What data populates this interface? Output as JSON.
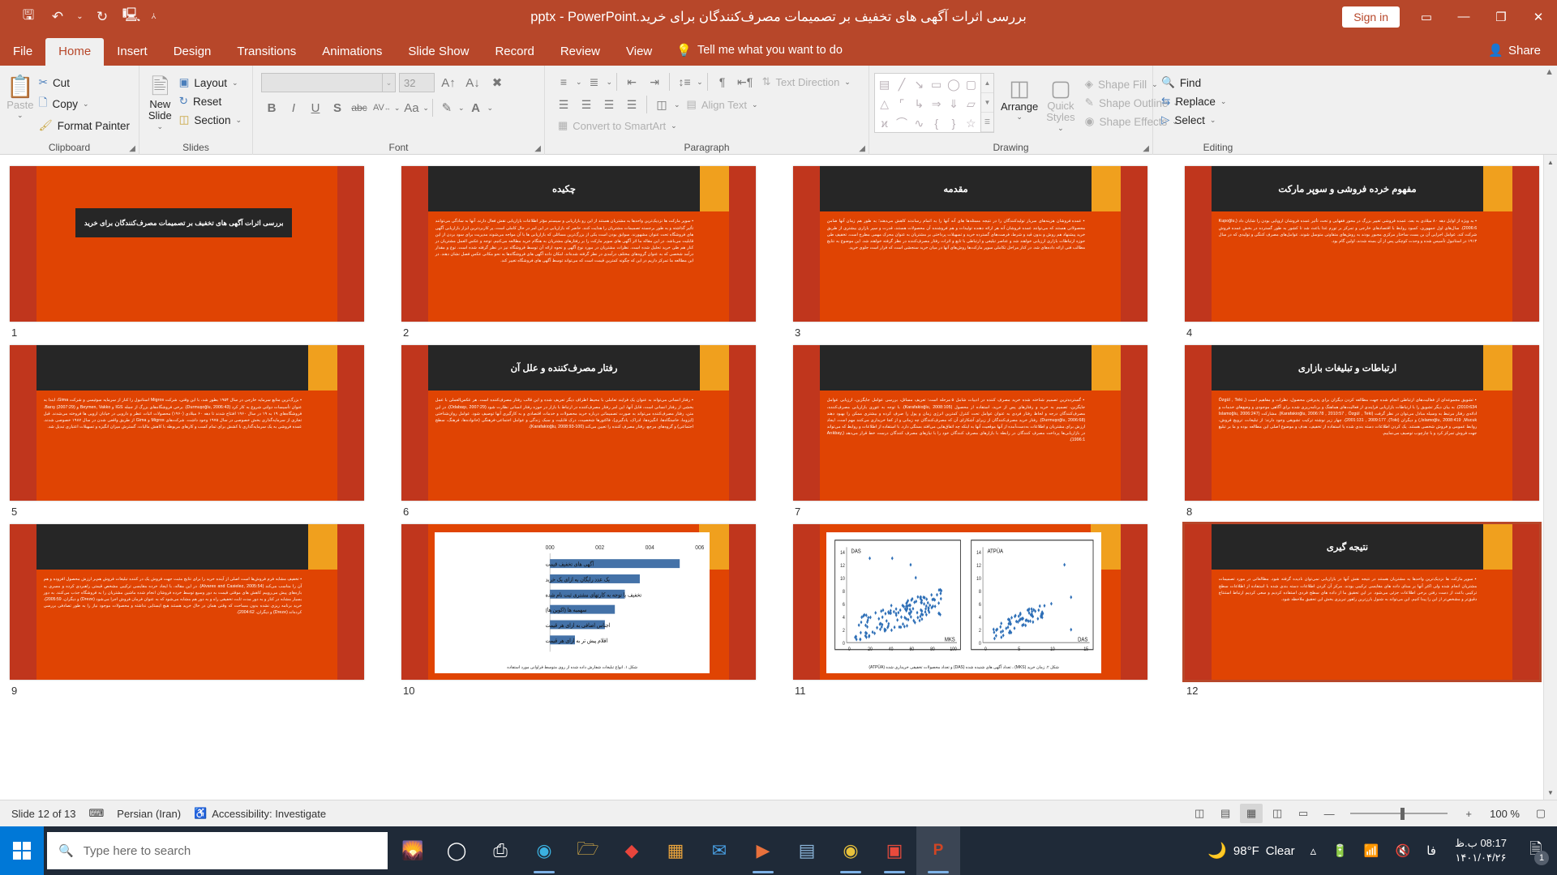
{
  "titlebar": {
    "document_title": "بررسی اثرات آگهی های تخفیف بر تصمیمات مصرف‌کنندگان برای خرید.pptx  -  PowerPoint",
    "signin_label": "Sign in",
    "qat": [
      {
        "name": "save-icon",
        "glyph": "🖫"
      },
      {
        "name": "undo-icon",
        "glyph": "↶"
      },
      {
        "name": "undo-dropdown-icon",
        "glyph": "⌄"
      },
      {
        "name": "redo-icon",
        "glyph": "↻"
      },
      {
        "name": "start-from-beginning-icon",
        "glyph": "🖳"
      },
      {
        "name": "customize-qat-icon",
        "glyph": "⩑"
      }
    ],
    "window_controls": [
      {
        "name": "ribbon-display-options-icon",
        "glyph": "▭"
      },
      {
        "name": "minimize-icon",
        "glyph": "—"
      },
      {
        "name": "restore-icon",
        "glyph": "❐"
      },
      {
        "name": "close-icon",
        "glyph": "✕"
      }
    ]
  },
  "tabs": [
    {
      "label": "File",
      "active": false
    },
    {
      "label": "Home",
      "active": true
    },
    {
      "label": "Insert",
      "active": false
    },
    {
      "label": "Design",
      "active": false
    },
    {
      "label": "Transitions",
      "active": false
    },
    {
      "label": "Animations",
      "active": false
    },
    {
      "label": "Slide Show",
      "active": false
    },
    {
      "label": "Record",
      "active": false
    },
    {
      "label": "Review",
      "active": false
    },
    {
      "label": "View",
      "active": false
    }
  ],
  "tellme": {
    "label": "Tell me what you want to do",
    "icon": "lightbulb-icon"
  },
  "share": {
    "label": "Share",
    "icon": "share-person-icon"
  },
  "ribbon": {
    "clipboard": {
      "group_label": "Clipboard",
      "paste_label": "Paste",
      "items": [
        {
          "label": "Cut",
          "icon": "scissors-icon"
        },
        {
          "label": "Copy",
          "icon": "copy-icon"
        },
        {
          "label": "Format Painter",
          "icon": "paintbrush-icon"
        }
      ]
    },
    "slides": {
      "group_label": "Slides",
      "new_slide_label": "New Slide",
      "items": [
        {
          "label": "Layout",
          "icon": "layout-icon"
        },
        {
          "label": "Reset",
          "icon": "reset-icon"
        },
        {
          "label": "Section",
          "icon": "section-icon"
        }
      ]
    },
    "font": {
      "group_label": "Font",
      "font_name_value": "",
      "font_name_placeholder": "",
      "font_size_value": "32",
      "buttons": [
        {
          "name": "bold-button",
          "glyph": "B"
        },
        {
          "name": "italic-button",
          "glyph": "I"
        },
        {
          "name": "underline-button",
          "glyph": "U"
        },
        {
          "name": "text-shadow-button",
          "glyph": "S"
        },
        {
          "name": "strikethrough-button",
          "glyph": "abc"
        },
        {
          "name": "character-spacing-button",
          "glyph": "AV"
        },
        {
          "name": "change-case-button",
          "glyph": "Aa"
        },
        {
          "name": "text-highlight-button",
          "glyph": "🖉"
        },
        {
          "name": "font-color-button",
          "glyph": "A"
        }
      ],
      "grow_font": "A⌃",
      "shrink_font": "A⌄",
      "clear_formatting": "⌫"
    },
    "paragraph": {
      "group_label": "Paragraph",
      "items": [
        {
          "label": "Text Direction",
          "icon": "text-direction-icon"
        },
        {
          "label": "Align Text",
          "icon": "align-text-icon"
        },
        {
          "label": "Convert to SmartArt",
          "icon": "smartart-icon"
        }
      ],
      "row1": [
        "bullets-icon",
        "numbering-icon",
        "decrease-indent-icon",
        "increase-indent-icon",
        "line-spacing-icon",
        "ltr-icon",
        "rtl-icon"
      ],
      "row2": [
        "align-left-icon",
        "align-center-icon",
        "align-right-icon",
        "justify-icon",
        "columns-icon"
      ]
    },
    "drawing": {
      "group_label": "Drawing",
      "arrange_label": "Arrange",
      "quick_styles_label": "Quick Styles",
      "items": [
        {
          "label": "Shape Fill",
          "icon": "shape-fill-icon"
        },
        {
          "label": "Shape Outline",
          "icon": "shape-outline-icon"
        },
        {
          "label": "Shape Effects",
          "icon": "shape-effects-icon"
        }
      ],
      "shapes": [
        "▤",
        "╲",
        "↘",
        "▭",
        "◯",
        "▢",
        "△",
        "⌐",
        "↳",
        "⇨",
        "⇩",
        "◱",
        "ϟ",
        "⌒",
        "∿",
        "{",
        "}",
        "☆"
      ]
    },
    "editing": {
      "group_label": "Editing",
      "items": [
        {
          "label": "Find",
          "icon": "search-icon"
        },
        {
          "label": "Replace",
          "icon": "replace-icon"
        },
        {
          "label": "Select",
          "icon": "select-icon"
        }
      ]
    }
  },
  "slides": [
    {
      "number": "1",
      "kind": "title",
      "title": "بررسی اثرات آگهی های تخفیف بر تصمیمات مصرف‌کنندگان برای خرید",
      "body": "",
      "selected": false
    },
    {
      "number": "2",
      "kind": "text",
      "title": "چکیده",
      "body": "سوپر مارکت ها نزدیک‌ترین واحدها به مشتریان هستند از این رو بازاریابی و سیستم مؤثر اطلاعات بازاریابی نقش فعال دارند. آنها به سادگی می‌توانند تأثیر گذاشته و به طور برجسته تصمیمات مشتریان را هدایت کنند. حاضر که بازاریابی در این امر در حال کاملی است، پر کاربردترین ابزار بازاریابی آگهی های فروشگاه تحت عنوان مشهورند. سوابق بودن است یکی از بزرگ‌ترین مسائلی که بازاریابی ها با آن مواجه می‌شوند مدیریت برای سود بردن از این قابلیت می‌باشد. در این مقاله ما اثر آگهی های سوپر مارکت را بر رفتارهای مشتریان به هنگام خرید مطالعه می‌کنیم. توجه و عکس العمل مشتریان در کنار هم طی خرید تحلیل شده است. نظرات مشتریان در مورد نوع آگهی و نحوه ارائه آن توسط فروشگاه نیز در نظر گرفته شده است. نوع و مقدار درآمد شخصی که به عنوان گروه‌های مختلف درآمدی در نظر گرفته شده‌اند. امکان داده آگهی های فروشگاه‌ها به نحو مکانی عکس فصل نشان دهند. در این مطالعه ما تمرکز داریم در این که چگونه کمترین قیمت است که می‌تواند توسط آگهی های فروشگاه تغییر کند.",
      "selected": false
    },
    {
      "number": "3",
      "kind": "text",
      "title": "مقدمه",
      "body": "عمده فروشان هزینه‌های سربار تولیدکنندگان را در نتیجه مسئله‌ها های آنه آنها را به اتمام رساندند کاهش می‌دهند؛ به طور هم زمان آنها ضامن محصولاتی هستند که می‌توانند عمده فروشان آنه هر ارائه دهنده تولیدات و هم فروشنده آن محصولات هستند، قدرت و سپر بازاری بیشتری از طریق خرید پیشنهاد هم روش و بدون قید و شرط، فرصت‌های گسترده خرید و تسهیلات پرداختی بر مشتریان به عنوان محرک مهمی مطرح است. تخفیف طی حوزه ارتباطات بازاری ارزیابی خواهند شد و عناصر تبلیغی و ارتباطی با تابع و اثرات رفتار مصرف‌کننده در نظر گرفته خواهند شد. این موضوع به نتایج مطالب فنی ارائه داده‌های شد. در کنار مراحل تکاملی سوپر مارکت‌ها روش‌های آنها در میان خرید سنجشی است که قرار است جلوی خرید.",
      "selected": false
    },
    {
      "number": "4",
      "kind": "text",
      "title": "مفهوم خرده فروشی و سوپر مارکت",
      "body": "به ویژه از اوایل دهه ۸۰ میلادی به بعد، عمده فروشی تغییر بزرگ در محور فقهایی و تحت تأثیر عمده فروشان اروپایی بودن را شایان داد (Kupoğlu, 2006:6). سال‌های اول جمهوری، کمبود روابط با اقتصادهای خارجی و تمرکز بر تورم غذا باعث شد تا کشور به طور گسترده در بخش عمده فروش شرکت کند. عوامل اجرایی آن بن بست ساختار مرکزی مجبور بودند به روش‌های متفاوتی متوسل شوند. عوامل‌های مصرف کننگی و تولیدی که در سال ۱۹۱۳ در استانبول تأسیس شده و وحدت کوچکی پس از آن بسته شدند، اولین گام بود.",
      "selected": false
    },
    {
      "number": "5",
      "kind": "text",
      "title": "",
      "body": "بزرگ‌ترین منابع سرمایه خارجی در سال ۱۹۵۴ بطور شد، با این وقتی، شرکت Migros استانبول را کنار از سرمایه سوئیسی و شرکت Gima، ابتدا به عنوان تأسیسات دولتی شروع به کار کرد (Durmuşoğlu, 2006:43). برخی فروشگاه‌های بزرگ از جمله IGS و Beymen, Vakko و Barış (2007:29). فروشگاه‌های ۱۹ به ۱۹ در سال ۱۹۶۰ افتتاح شدند تا دهه ۶۰ میلادی (۱۹۶۰) محصولات اثبات عطر و دارویی در خیابان اروپی ها فروخته می‌شدند. قبل تجاری از سرمایه‌گذاری بخش خصوصی در سال ۱۹۷۵ وجود داشت. شرکت‌های Migros و Gima از طریق واقعی شدن در سال ۱۹۸۷ خصوصی شدند. عمده فروشی به یک سرمایه‌گذاری با کشش برای تمام کسب و کارهای مربوطه با کاهش مالیات، گسترش میزان انگیزه و تسهیلات اعتباری تبدیل شد.",
      "selected": false
    },
    {
      "number": "6",
      "kind": "text",
      "title": "رفتار مصرف‌کننده و علل آن",
      "body": "رفتار انسانی می‌تواند به عنوان یک فرایند تعاملی با محیط اطراف دیگر تعریف شده و این قالب رفتار مصرف‌کننده است. هر عکس‌العملی با عمل بخشی از رفتار انسانی است، قابل آنها، این امر رفتار مصرف‌کننده در ارتباط با بازار در حوزه رفتار انسانی نظارت شود (Odabaşı, 2007:29). در این متن، رفتار مصرف‌کننده می‌تواند به صورت تصمیماتی درباره خرید محصولات و خدمات اقتصادی و به کارگیری آنها توصیف شود. عوامل روان‌شناختی (ایزوما، خاستگاه‌ها، انگیزه‌ها، ادراک، یادگیری)، فاکتورها شخصیت، درک قابلیت و سبک زندگی و عوامل اجتماعی-فرهنگی (خانواده‌ها، فرهنگ، سطح اجتماعی) و گروه‌های مرجع، رفتار مصرف کننده را تعیین می‌کند (Karafakioğlu, 2008:93-100).",
      "selected": false
    },
    {
      "number": "7",
      "kind": "text",
      "title": "",
      "body": "گسترده‌ترین تصمیم شناخته شده خرید مصرف کننده در ادبیات شامل ۵ مرحله است: تعریف مسائل، بررسی عوامل جایگزین، ارزیابی عوامل جایگزین، تصمیم به خرید و رفتارهای پس از خرید، استفاده از محصول (Karafakioğlu, 2008:105). با توجه به تئوری بازاریابی مصرف‌کننده، مصرف‌کنندگان درجه و لحاظ رفتار فردی به عنوان عوامل تحت کنترل کمترین انرژی زمان و پول را صرف کرده و بیشتری ممکن را بهبود دهند (Durmuşoğlu, 2006:68). رفتار خرید مصرف‌کنندگان از زیرای آشکارای آن که مصرف‌کنندگان چه زمانی و از کجا خریداری می‌کنند مهم است. ایجاد ارزش برای مشتریان و اطلاعات به‌دست‌آمده از آنها موقعیت آنها به اینکه چه اتفاق‌هایی می‌افتد بستگی دارد. با استفاده از اطلاعات و روابط که می‌تواند در بازاریابی‌ها پرداخت مصرف کنندگان در رابطه با بازارهای مصرف کنندگان خود را با نیازهای مصرف کنندگان درست خط قرار می‌دهد (Arıkbay, 1996:1).",
      "selected": false
    },
    {
      "number": "8",
      "kind": "text",
      "title": "ارتباطات و تبلیغات بازاری",
      "body": "تشویق مجموعه‌ای از فعالیت‌های ارتباطی انجام شده جهت مطالعه کردن دیگران برای پذیرفتن محصول، نظرات و مفاهیم است (Özgül , Teki , 2010:634). به بیان دیگر تشویق را با ارتباطات بازاریابی فرایندی از فعالیت‌های هماهنگ و برنامه‌ریزی شده برای آگاهی موجودی و وضع‌های خدمات و ادائه‌ی رفتار مرتبط به وسیله مبادل می‌توان در نظر گرفت (Karafakioğlu, 2006:78 , 2010:57 , Özgül , Teki). مشارکت (Islamoğlu, 2006:247 ,Islamoğlu, 2008:419 ,Mucuk) و دیگران (Toki), 2001:131 , 2009:177). چهار زیر نوشته ترکیب تشویقی وجود دارند: از تبلیغات، ترویج فروش، روابط عمومی و فروش شخصی هستند. یک کردن اطلاعات دسته بندی شده با استفاده از تخفیف، هدف و موضوع اصلی این مطالعه بوده و ما بر تبلیغ جهت فروش تمرکز کرد و با چارچوب توصیف می‌نماییم.",
      "selected": false
    },
    {
      "number": "9",
      "kind": "text",
      "title": "",
      "body": "تخفیف مشابه فرم فروش‌ها است اصلی از آینده خرید را برای نتایج مثبت جهت فروش یک در کننده تبلیغات فروش هم‌بر ارزش محصول افزوده و هم آن را مناسب می‌کند (Alvares and Casielez, 2005:54). در این مقاله، با ایجاد خرده مقایسی ترکیبی مشخص قیمتی راهبردی کرده و مسری به بازه‌های پیش می‌روییم کاهش های موقتی قیمت به دور وسیع توسط خرده فروشان انجام شده ماشین مشتریان را به فروشگاه جذب می‌کنند. به دور بسیار مشابه در کنار و به دور مدت ثابت تخفیقی راه و به دور هم مشابه می‌شود که به عنوان فرمان فروش اجرا می‌شود (Dreze) و دیگران، 2005:59). خرید برنامه ریزی نشده بدون مساحت که وقتی همان در حال خرید هستند هیچ ایستایی نداشته و محصولات موجود نیاز را به طور تصادفی بررسی کرده‌اند (Dreze) و دیگران، 2004:62).",
      "selected": false
    },
    {
      "number": "10",
      "kind": "chart-bar",
      "title": "",
      "body": "",
      "figure_caption": "شکل ۱. انواع تبلیغات شفارش داده شده از روی متوسط فراوانی مورد استفاده",
      "selected": false
    },
    {
      "number": "11",
      "kind": "chart-scatter",
      "title": "",
      "body": "",
      "figure_caption": "شکل ۲. زمان خرید (MKS) ، تعداد آگهی های شنیده شده (DAS) و تعداد محصولات تخفیفی خریداری شده (ATPÜA)",
      "selected": false
    },
    {
      "number": "12",
      "kind": "text",
      "title": "نتیجه گیری",
      "body": "سوپر مارکت ها نزدیک‌ترین واحدها به مشتریان هستند در نتیجه نقش آنها در بازاریابی نمی‌توان نادیده گرفته شود. مطالعاتی در مورد تصمیمات مشتریان انجام شده ولی اکثر آنها بر مبنای داده های مقایسی ترکیبی بودند. مرکز آن کردن اطلاعات دسته بندی شده با استفاده از اطلاعات سطح ترکیبی باعث از دست رفتن برخی اطلاعات جزئی می‌شود. در این تحقیق ما از داده های سطح فردی استفاده کردیم و سعی کردیم ارتباط استنتاج دقیق‌تر و مشخص‌تر از این را پیدا کنیم. این می‌تواند به شنول بارزترین راهور تبریزی بخش این تحقیق ملاحظه شود.",
      "selected": true
    }
  ],
  "bar_chart_data": {
    "type": "bar",
    "title": "",
    "categories": [
      "آگهی های تخفیف قیمت",
      "یک عدد رایگان به ازای یک خرید",
      "تخفیف با توجه به کارتهای مشتری ثبت نام شده",
      "سهمیه ها (اکوین ها)",
      "اجناس اضافی به ازای هر قیمت",
      "اقلام پیش تر به ازای هر قیمت"
    ],
    "values": [
      5.2,
      3.6,
      3.0,
      2.6,
      2.2,
      1.0
    ],
    "x_ticks": [
      "000",
      "002",
      "004",
      "006"
    ],
    "xlim": [
      0,
      6
    ],
    "series_color": "#4472a8"
  },
  "scatter_chart_data": [
    {
      "type": "scatter",
      "y_label": "DAS",
      "x_label": "MKS",
      "y_ticks": [
        0,
        2,
        4,
        6,
        8,
        10,
        12,
        14
      ],
      "x_ticks": [
        0,
        20,
        40,
        60,
        80,
        100
      ],
      "marker_color": "#2e6fb7"
    },
    {
      "type": "scatter",
      "y_label": "ATPÜA",
      "x_label": "DAS",
      "y_ticks": [
        0,
        2,
        4,
        6,
        8,
        10,
        12,
        14
      ],
      "x_ticks": [
        0,
        5,
        10,
        15
      ],
      "marker_color": "#2e6fb7"
    }
  ],
  "statusbar": {
    "slide_counter": "Slide 12 of 13",
    "spellcheck_icon": "spellcheck-icon",
    "language": "Persian (Iran)",
    "accessibility_icon": "accessibility-icon",
    "accessibility": "Accessibility: Investigate",
    "notes_icon": "notes-icon",
    "views": [
      {
        "name": "normal-view-button",
        "glyph": "▤",
        "active": false
      },
      {
        "name": "slide-sorter-view-button",
        "glyph": "▦",
        "active": true
      },
      {
        "name": "reading-view-button",
        "glyph": "▥",
        "active": false
      },
      {
        "name": "slideshow-view-button",
        "glyph": "▭",
        "active": false
      }
    ],
    "zoom_out": "—",
    "zoom_in": "+",
    "zoom_level": "100 %",
    "fit_icon": "fit-to-window-icon"
  },
  "taskbar": {
    "start_icon": "windows-start-icon",
    "search_placeholder": "Type here to search",
    "search_icon": "search-icon",
    "apps": [
      {
        "name": "cortana-icon",
        "glyph": "◯"
      },
      {
        "name": "task-view-icon",
        "glyph": "❏"
      },
      {
        "name": "edge-icon",
        "glyph": "◉"
      },
      {
        "name": "file-explorer-icon",
        "glyph": "📁"
      },
      {
        "name": "adobe-icon",
        "glyph": "◆"
      },
      {
        "name": "store-icon",
        "glyph": "🛍"
      },
      {
        "name": "mail-icon",
        "glyph": "✉"
      },
      {
        "name": "media-player-icon",
        "glyph": "▶"
      },
      {
        "name": "calculator-icon",
        "glyph": "🖩"
      },
      {
        "name": "chrome-icon",
        "glyph": "◍"
      },
      {
        "name": "pdf-icon",
        "glyph": "▣"
      },
      {
        "name": "powerpoint-icon",
        "glyph": "P"
      }
    ],
    "weather_icon": "moon-icon",
    "weather_temp": "98°F",
    "weather_desc": "Clear",
    "tray": [
      {
        "name": "show-hidden-icons-icon",
        "glyph": "⌃"
      },
      {
        "name": "battery-icon",
        "glyph": "🔋"
      },
      {
        "name": "network-icon",
        "glyph": "📶"
      },
      {
        "name": "volume-muted-icon",
        "glyph": "🔇"
      },
      {
        "name": "language-indicator",
        "glyph": "فا"
      }
    ],
    "clock_time": "08:17 ب.ظ",
    "clock_date": "۱۴۰۱/۰۴/۲۶",
    "notification_icon": "notification-icon",
    "notification_count": "1"
  }
}
